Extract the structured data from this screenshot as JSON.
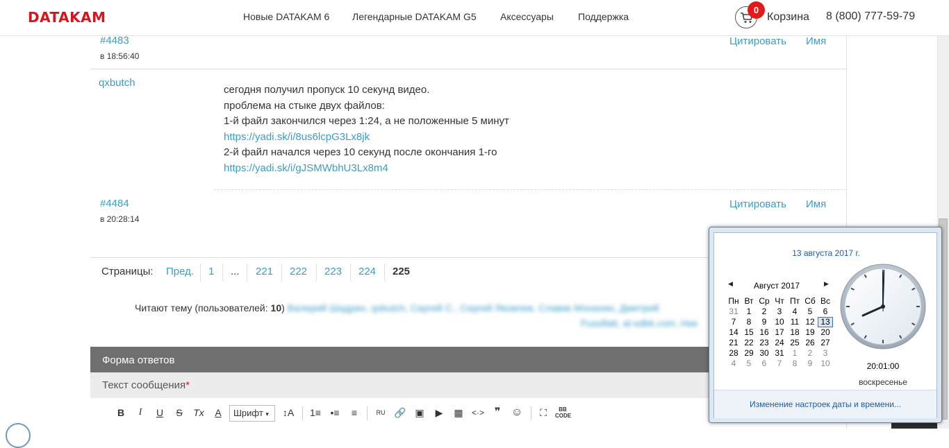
{
  "header": {
    "logo": "DATAKAM",
    "nav": [
      "Новые DATAKAM 6",
      "Легендарные DATAKAM G5",
      "Аксессуары",
      "Поддержка"
    ],
    "cart_count": "0",
    "cart_label": "Корзина",
    "phone": "8 (800) 777-59-79"
  },
  "posts": [
    {
      "id": "#4483",
      "time": "в 18:56:40",
      "quote": "Цитировать",
      "name": "Имя"
    },
    {
      "id": "#4484",
      "time": "в 20:28:14",
      "quote": "Цитировать",
      "name": "Имя"
    }
  ],
  "message": {
    "author": "qxbutch",
    "lines": [
      "сегодня получил пропуск 10 секунд видео.",
      "проблема на стыке двух файлов:",
      "1-й файл закончился через 1:24, а не положенные 5 минут",
      "https://yadi.sk/i/8us6lcpG3Lx8jk",
      "2-й файл начался через 10 секунд после окончания 1-го",
      "https://yadi.sk/i/gJSMWbhU3Lx8m4"
    ]
  },
  "pager": {
    "label": "Страницы:",
    "prev": "Пред.",
    "items": [
      "1",
      "...",
      "221",
      "222",
      "223",
      "224",
      "225"
    ]
  },
  "readers": {
    "prefix": "Читают тему (пользователей: ",
    "count": "10",
    "suffix": ")",
    "names_line1": "Валерий Шадрин, qxbutch, Сергей С., Сергей Яковлев, Славик Монахин, Дмитрий",
    "names_line2": "Fussflatt, al-sdbk.com, Ник"
  },
  "form": {
    "title": "Форма ответов",
    "message_label": "Текст сообщения",
    "required_mark": "*",
    "font_select": "Шрифт",
    "toolbar": [
      "B",
      "I",
      "U",
      "S",
      "Tx",
      "A",
      "↕A",
      "1≡",
      "•≡",
      "≡",
      "RU",
      "🔗",
      "▣",
      "▶",
      "▦",
      "<·>",
      "❞",
      "☺",
      "⛶",
      "BB CODE"
    ]
  },
  "calendar": {
    "date_link": "13 августа 2017 г.",
    "month": "Август 2017",
    "weekdays": [
      "Пн",
      "Вт",
      "Ср",
      "Чт",
      "Пт",
      "Сб",
      "Вс"
    ],
    "weeks": [
      [
        "31",
        "1",
        "2",
        "3",
        "4",
        "5",
        "6"
      ],
      [
        "7",
        "8",
        "9",
        "10",
        "11",
        "12",
        "13"
      ],
      [
        "14",
        "15",
        "16",
        "17",
        "18",
        "19",
        "20"
      ],
      [
        "21",
        "22",
        "23",
        "24",
        "25",
        "26",
        "27"
      ],
      [
        "28",
        "29",
        "30",
        "31",
        "1",
        "2",
        "3"
      ],
      [
        "4",
        "5",
        "6",
        "7",
        "8",
        "9",
        "10"
      ]
    ],
    "today": "13",
    "time": "20:01:00",
    "weekday": "воскресенье",
    "settings": "Изменение настроек даты и времени..."
  }
}
